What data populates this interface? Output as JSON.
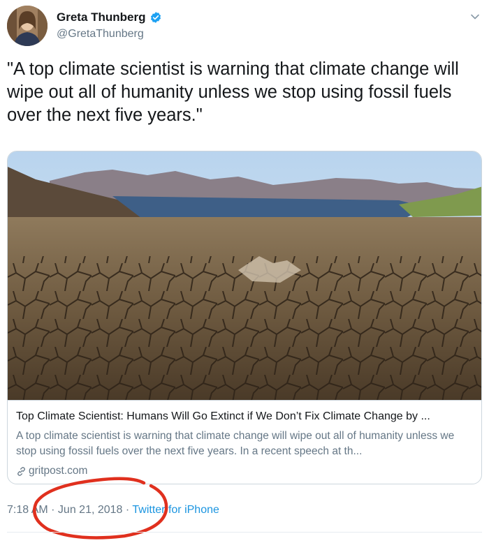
{
  "author": {
    "name": "Greta Thunberg",
    "handle": "@GretaThunberg",
    "verified": true
  },
  "tweet": {
    "text": "\"A top climate scientist is warning that climate change will wipe out all of humanity unless we stop using fossil fuels over the next five years.\""
  },
  "card": {
    "title": "Top Climate Scientist: Humans Will Go Extinct if We Don’t Fix Climate Change by ...",
    "description": "A top climate scientist is warning that climate change will wipe out all of humanity unless we stop using fossil fuels over the next five years. In a recent speech at th...",
    "domain": "gritpost.com"
  },
  "meta": {
    "time": "7:18 AM",
    "separator": " · ",
    "date": "Jun 21, 2018",
    "source": "Twitter for iPhone"
  },
  "colors": {
    "link_blue": "#1b95e0",
    "secondary_text": "#657786",
    "annotation_red": "#e0301e"
  },
  "icons": [
    "verified-badge-icon",
    "chevron-down-icon",
    "link-icon"
  ]
}
